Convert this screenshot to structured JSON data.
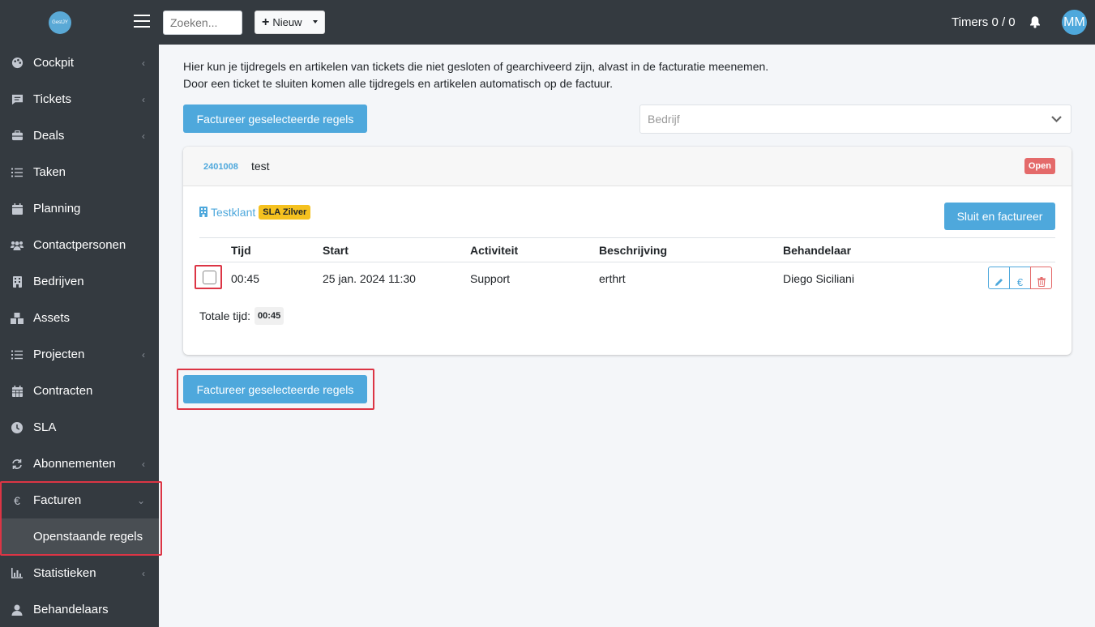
{
  "sidebar": {
    "brand": "GestJY",
    "items": [
      {
        "label": "Cockpit",
        "icon": "palette-icon",
        "chevron": "‹"
      },
      {
        "label": "Tickets",
        "icon": "message-icon",
        "chevron": "‹"
      },
      {
        "label": "Deals",
        "icon": "briefcase-icon",
        "chevron": "‹"
      },
      {
        "label": "Taken",
        "icon": "list-icon",
        "chevron": ""
      },
      {
        "label": "Planning",
        "icon": "calendar-icon",
        "chevron": ""
      },
      {
        "label": "Contactpersonen",
        "icon": "users-icon",
        "chevron": ""
      },
      {
        "label": "Bedrijven",
        "icon": "building-icon",
        "chevron": ""
      },
      {
        "label": "Assets",
        "icon": "cubes-icon",
        "chevron": ""
      },
      {
        "label": "Projecten",
        "icon": "list-icon",
        "chevron": "‹"
      },
      {
        "label": "Contracten",
        "icon": "calendar-grid-icon",
        "chevron": ""
      },
      {
        "label": "SLA",
        "icon": "clock-icon",
        "chevron": ""
      },
      {
        "label": "Abonnementen",
        "icon": "sync-icon",
        "chevron": "‹"
      },
      {
        "label": "Facturen",
        "icon": "euro-icon",
        "chevron": "⌄"
      },
      {
        "label": "Statistieken",
        "icon": "chart-icon",
        "chevron": "‹"
      },
      {
        "label": "Behandelaars",
        "icon": "user-icon",
        "chevron": ""
      }
    ],
    "sub_item": "Openstaande regels"
  },
  "topbar": {
    "search_placeholder": "Zoeken...",
    "new_label": "Nieuw",
    "timers": "Timers 0 / 0",
    "avatar": "MM"
  },
  "main": {
    "intro_line1": "Hier kun je tijdregels en artikelen van tickets die niet gesloten of gearchiveerd zijn, alvast in de facturatie meenemen.",
    "intro_line2": "Door een ticket te sluiten komen alle tijdregels en artikelen automatisch op de factuur.",
    "invoice_button": "Factureer geselecteerde regels",
    "company_placeholder": "Bedrijf"
  },
  "ticket": {
    "number": "2401008",
    "title": "test",
    "status": "Open",
    "client": "Testklant",
    "sla": "SLA Zilver",
    "close_button": "Sluit en factureer",
    "columns": [
      "Tijd",
      "Start",
      "Activiteit",
      "Beschrijving",
      "Behandelaar"
    ],
    "rows": [
      {
        "tijd": "00:45",
        "start": "25 jan. 2024 11:30",
        "activiteit": "Support",
        "beschrijving": "erthrt",
        "behandelaar": "Diego Siciliani",
        "euro": "€"
      }
    ],
    "total_label": "Totale tijd:",
    "total_value": "00:45"
  },
  "colors": {
    "sidebar_bg": "#343a40",
    "primary": "#4ea8dc",
    "danger": "#e46a6a",
    "sla": "#f5c11f",
    "highlight": "#dc3545"
  }
}
